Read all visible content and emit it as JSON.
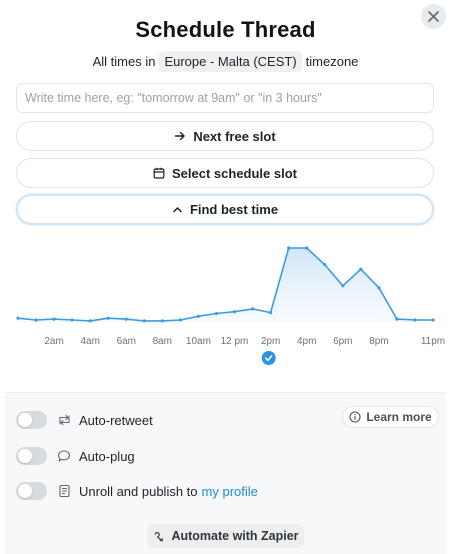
{
  "header": {
    "title": "Schedule Thread",
    "tz_prefix": "All times in",
    "tz_value": "Europe - Malta (CEST)",
    "tz_suffix": "timezone"
  },
  "time_input": {
    "value": "",
    "placeholder": "Write time here, eg: \"tomorrow at 9am\" or \"in 3 hours\""
  },
  "buttons": {
    "next_free_slot": "Next free slot",
    "select_schedule_slot": "Select schedule slot",
    "find_best_time": "Find best time",
    "learn_more": "Learn more",
    "automate_zapier": "Automate with Zapier"
  },
  "options": {
    "auto_retweet": {
      "label": "Auto-retweet",
      "enabled": false
    },
    "auto_plug": {
      "label": "Auto-plug",
      "enabled": false
    },
    "unroll": {
      "label": "Unroll and publish to",
      "link": "my profile",
      "enabled": false
    }
  },
  "colors": {
    "accent": "#2b93e0",
    "line": "#3b9be5",
    "fill": "#d6e9fa"
  },
  "icons": {
    "close": "close-icon",
    "next": "arrow-right-icon",
    "calendar": "calendar-icon",
    "chevron": "chevron-up-icon",
    "retweet": "retweet-icon",
    "plug": "speech-bubble-icon",
    "unroll": "document-icon",
    "info": "info-icon",
    "zapier": "zapier-icon",
    "selected": "check-circle-icon"
  },
  "chart_data": {
    "type": "area",
    "x": [
      0,
      1,
      2,
      3,
      4,
      5,
      6,
      7,
      8,
      9,
      10,
      11,
      12,
      13,
      14,
      15,
      16,
      17,
      18,
      19,
      20,
      21,
      22,
      23
    ],
    "values": [
      2,
      0,
      1,
      0,
      -1,
      2,
      1,
      -1,
      -1,
      0,
      4,
      7,
      9,
      12,
      8,
      78,
      78,
      60,
      37,
      55,
      35,
      1,
      0,
      0
    ],
    "tick_labels": [
      "2am",
      "4am",
      "6am",
      "8am",
      "10am",
      "12 pm",
      "2pm",
      "4pm",
      "6pm",
      "8pm",
      "11pm"
    ],
    "tick_positions": [
      2,
      4,
      6,
      8,
      10,
      12,
      14,
      16,
      18,
      20,
      23
    ],
    "selected_index": 15,
    "grid": false,
    "legend": "none"
  }
}
